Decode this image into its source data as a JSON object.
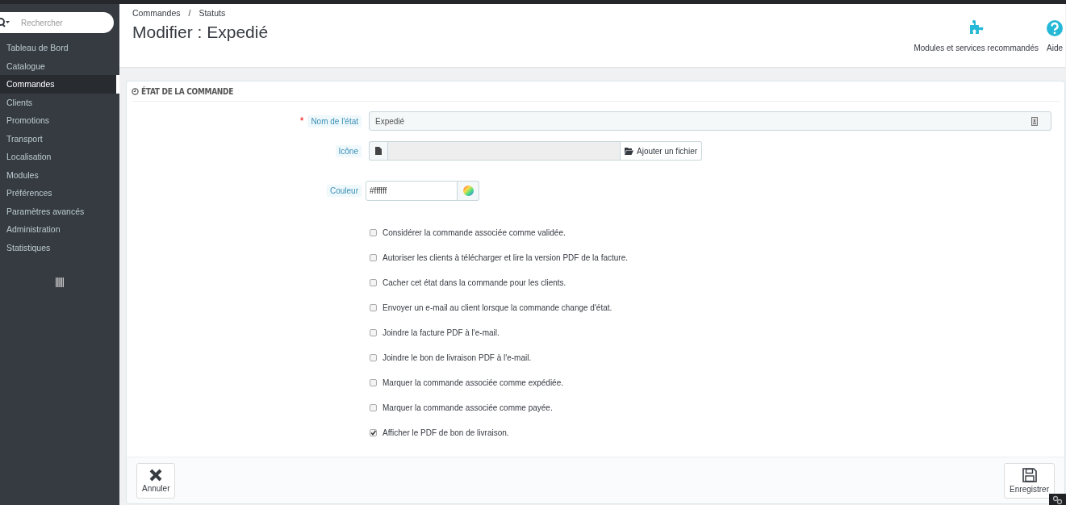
{
  "sidebar": {
    "search": {
      "placeholder": "Rechercher"
    },
    "items": [
      {
        "label": "Tableau de Bord",
        "selected": false
      },
      {
        "label": "Catalogue",
        "selected": false
      },
      {
        "label": "Commandes",
        "selected": true
      },
      {
        "label": "Clients",
        "selected": false
      },
      {
        "label": "Promotions",
        "selected": false
      },
      {
        "label": "Transport",
        "selected": false
      },
      {
        "label": "Localisation",
        "selected": false
      },
      {
        "label": "Modules",
        "selected": false
      },
      {
        "label": "Préférences",
        "selected": false
      },
      {
        "label": "Paramètres avancés",
        "selected": false
      },
      {
        "label": "Administration",
        "selected": false
      },
      {
        "label": "Statistiques",
        "selected": false
      }
    ]
  },
  "header": {
    "breadcrumb": [
      "Commandes",
      "Statuts"
    ],
    "breadcrumb_separator": "/",
    "title": "Modifier : Expedié",
    "actions": [
      {
        "kind": "modules",
        "label": "Modules et services recommandés"
      },
      {
        "kind": "help",
        "label": "Aide"
      }
    ]
  },
  "panel": {
    "title": "ÉTAT DE LA COMMANDE",
    "required_mark": "*",
    "fields": [
      {
        "kind": "text",
        "label": "Nom de l'état",
        "required": true,
        "value": "Expedié"
      },
      {
        "kind": "file",
        "label": "Icône",
        "required": false,
        "button": "Ajouter un fichier"
      },
      {
        "kind": "color",
        "label": "Couleur",
        "required": false,
        "value": "#ffffff"
      }
    ],
    "options": [
      {
        "label": "Considérer la commande associée comme validée.",
        "checked": false
      },
      {
        "label": "Autoriser les clients à télécharger et lire la version PDF de la facture.",
        "checked": false
      },
      {
        "label": "Cacher cet état dans la commande pour les clients.",
        "checked": false
      },
      {
        "label": "Envoyer un e-mail au client lorsque la commande change d'état.",
        "checked": false
      },
      {
        "label": "Joindre la facture PDF à l'e-mail.",
        "checked": false
      },
      {
        "label": "Joindre le bon de livraison PDF à l'e-mail.",
        "checked": false
      },
      {
        "label": "Marquer la commande associée comme expédiée.",
        "checked": false
      },
      {
        "label": "Marquer la commande associée comme payée.",
        "checked": false
      },
      {
        "label": "Afficher le PDF de bon de livraison.",
        "checked": true
      }
    ],
    "buttons": [
      {
        "kind": "cancel",
        "label": "Annuler"
      },
      {
        "kind": "save",
        "label": "Enregistrer"
      }
    ]
  }
}
